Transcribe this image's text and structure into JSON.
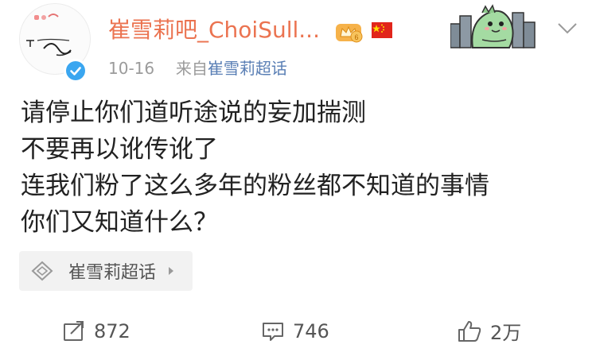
{
  "header": {
    "username": "崔雪莉吧_ChoiSull...",
    "date": "10-16",
    "source_prefix": "来自",
    "source_name": "崔雪莉超话"
  },
  "post": {
    "lines": [
      "请停止你们道听途说的妄加揣测",
      "不要再以讹传讹了",
      "连我们粉了这么多年的粉丝都不知道的事情",
      "你们又知道什么？"
    ]
  },
  "topic": {
    "label": "崔雪莉超话"
  },
  "actions": {
    "repost_count": "872",
    "comment_count": "746",
    "like_count": "2万"
  },
  "colors": {
    "username": "#eb7350",
    "verified": "#3aa6f0",
    "source_link": "#5a7fb5"
  },
  "icons": [
    "verified-icon",
    "crown-badge-icon",
    "china-flag-icon",
    "chevron-down-icon",
    "super-topic-icon",
    "repost-icon",
    "comment-icon",
    "like-icon"
  ]
}
